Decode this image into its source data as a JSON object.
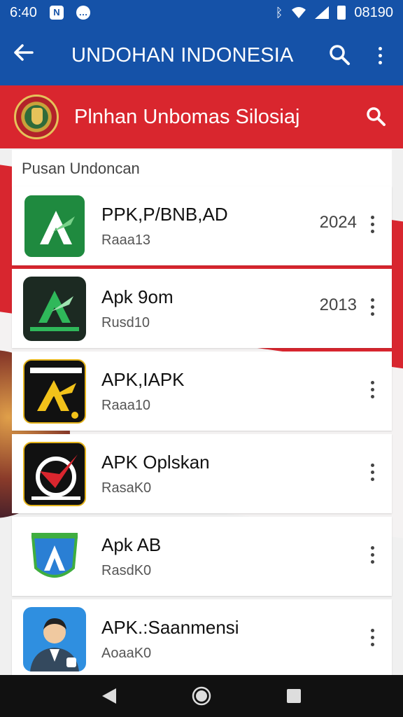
{
  "status_bar": {
    "time": "6:40",
    "right_text": "08190"
  },
  "app_bar": {
    "title": "UNDOHAN INDONESIA"
  },
  "banner": {
    "title": "Plnhan Unbomas Silosiaj"
  },
  "list": {
    "header": "Pusan Undoncan",
    "items": [
      {
        "title": "PPK,P/BNB,AD",
        "subtitle": "Raaa13",
        "year": "2024",
        "icon": "green-ap-icon"
      },
      {
        "title": "Apk 9om",
        "subtitle": "Rusd10",
        "year": "2013",
        "icon": "dark-green-ap-icon"
      },
      {
        "title": "APK,IAPK",
        "subtitle": "Raaa10",
        "year": "",
        "icon": "yellow-ap-icon"
      },
      {
        "title": "APK Oplskan",
        "subtitle": "RasaK0",
        "year": "",
        "icon": "red-check-icon"
      },
      {
        "title": "Apk AB",
        "subtitle": "RasdK0",
        "year": "",
        "icon": "blue-shield-icon"
      },
      {
        "title": "APK.:Saanmensi",
        "subtitle": "AoaaK0",
        "year": "",
        "icon": "man-avatar-icon"
      }
    ]
  },
  "colors": {
    "primary": "#1552a8",
    "banner": "#d9262e",
    "nav": "#111111"
  }
}
